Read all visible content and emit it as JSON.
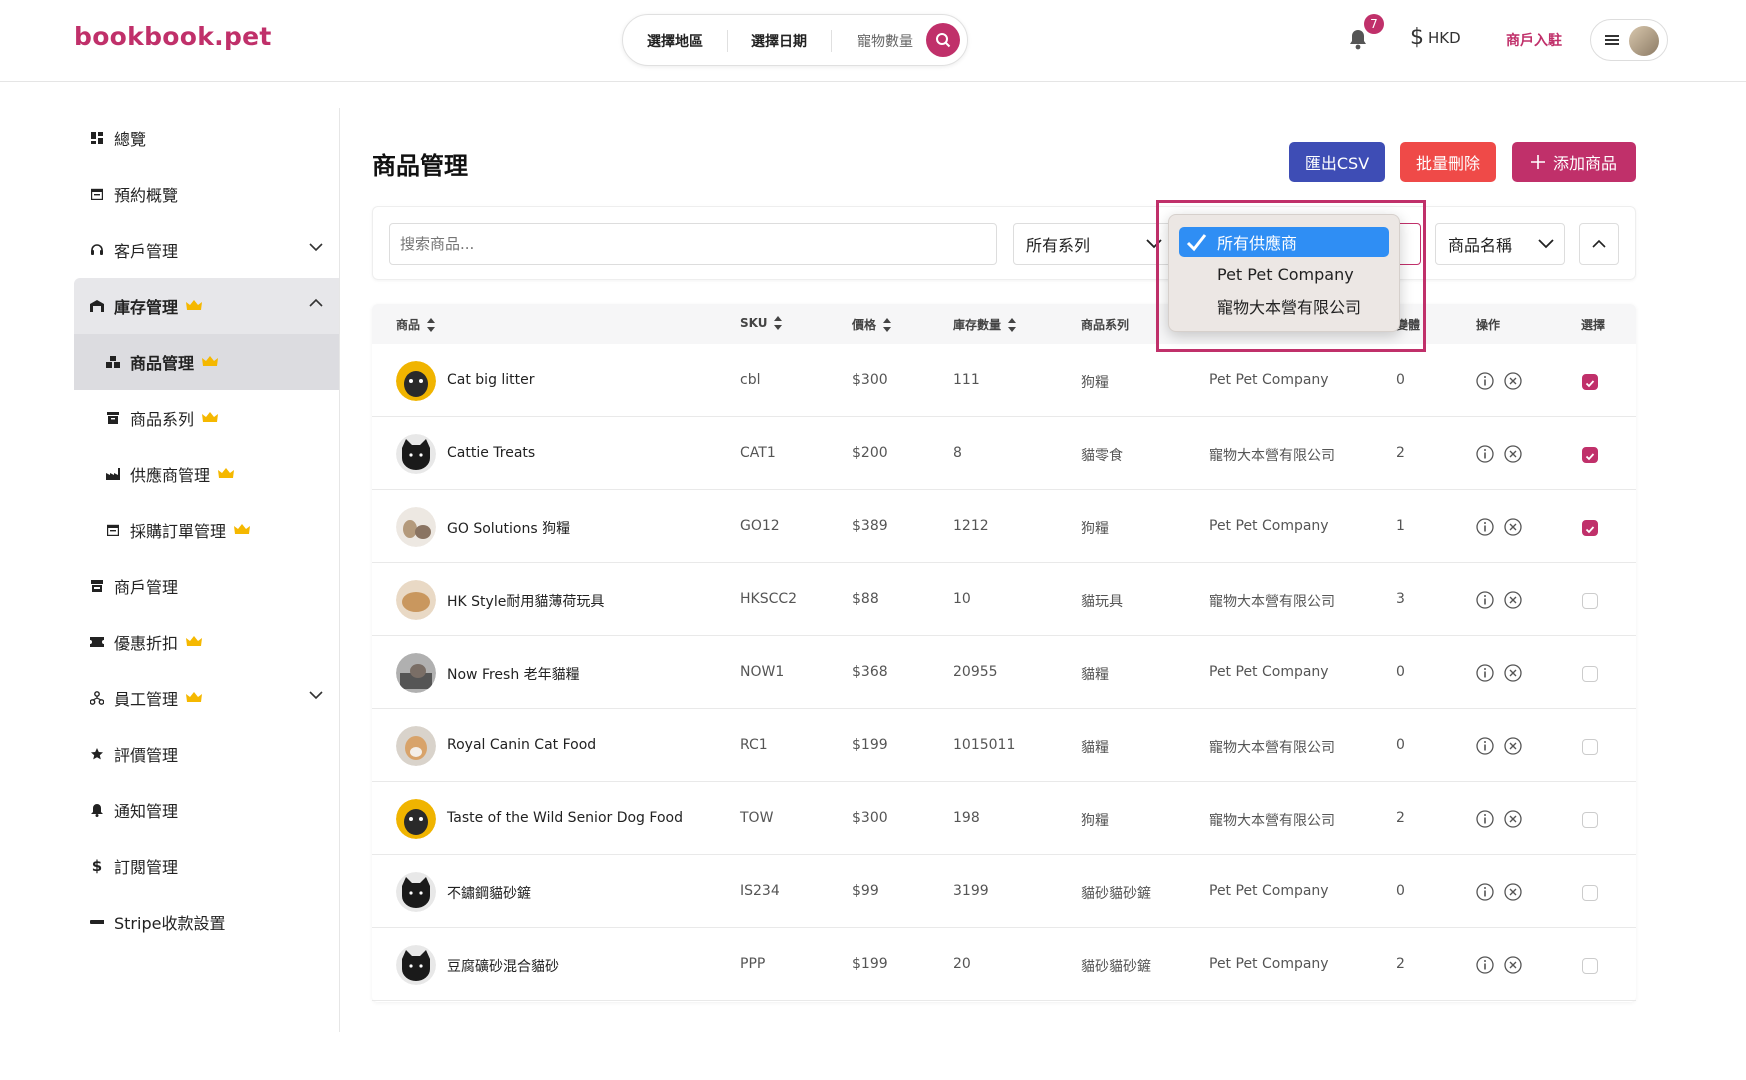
{
  "header": {
    "logo": "bookbook.pet",
    "search": {
      "region": "選擇地區",
      "date": "選擇日期",
      "pets": "寵物數量"
    },
    "notification_count": "7",
    "currency": "HKD",
    "merchant_link": "商戶入駐"
  },
  "sidebar": {
    "items": [
      {
        "label": "總覽",
        "icon": "dashboard-icon"
      },
      {
        "label": "預約概覽",
        "icon": "calendar-icon"
      },
      {
        "label": "客戶管理",
        "icon": "headset-icon"
      },
      {
        "label": "庫存管理",
        "icon": "warehouse-icon"
      },
      {
        "label": "商品管理",
        "icon": "boxes-icon"
      },
      {
        "label": "商品系列",
        "icon": "archive-icon"
      },
      {
        "label": "供應商管理",
        "icon": "factory-icon"
      },
      {
        "label": "採購訂單管理",
        "icon": "calendar-icon"
      },
      {
        "label": "商戶管理",
        "icon": "store-icon"
      },
      {
        "label": "優惠折扣",
        "icon": "ticket-icon"
      },
      {
        "label": "員工管理",
        "icon": "org-icon"
      },
      {
        "label": "評價管理",
        "icon": "star-icon"
      },
      {
        "label": "通知管理",
        "icon": "bell-icon"
      },
      {
        "label": "訂閱管理",
        "icon": "dollar-icon"
      },
      {
        "label": "Stripe收款設置",
        "icon": "stripe-icon"
      }
    ]
  },
  "page": {
    "title": "商品管理",
    "export_csv": "匯出CSV",
    "bulk_delete": "批量刪除",
    "add_product": "添加商品"
  },
  "filters": {
    "search_placeholder": "搜索商品...",
    "series_selected": "所有系列",
    "sort_selected": "商品名稱",
    "supplier_options": [
      "所有供應商",
      "Pet Pet Company",
      "寵物大本營有限公司"
    ]
  },
  "table": {
    "columns": [
      "商品",
      "SKU",
      "價格",
      "庫存數量",
      "商品系列",
      "變體",
      "操作",
      "選擇"
    ],
    "rows": [
      {
        "name": "Cat big litter",
        "sku": "cbl",
        "price": "$300",
        "stock": "111",
        "series": "狗糧",
        "supplier": "Pet Pet Company",
        "variants": "0",
        "selected": true,
        "thumb": "pug"
      },
      {
        "name": "Cattie Treats",
        "sku": "CAT1",
        "price": "$200",
        "stock": "8",
        "series": "貓零食",
        "supplier": "寵物大本營有限公司",
        "variants": "2",
        "selected": true,
        "thumb": "blackcat"
      },
      {
        "name": "GO Solutions 狗糧",
        "sku": "GO12",
        "price": "$389",
        "stock": "1212",
        "series": "狗糧",
        "supplier": "Pet Pet Company",
        "variants": "1",
        "selected": true,
        "thumb": "photo1"
      },
      {
        "name": "HK Style耐用貓薄荷玩具",
        "sku": "HKSCC2",
        "price": "$88",
        "stock": "10",
        "series": "貓玩具",
        "supplier": "寵物大本營有限公司",
        "variants": "3",
        "selected": false,
        "thumb": "photo2"
      },
      {
        "name": "Now Fresh 老年貓糧",
        "sku": "NOW1",
        "price": "$368",
        "stock": "20955",
        "series": "貓糧",
        "supplier": "Pet Pet Company",
        "variants": "0",
        "selected": false,
        "thumb": "photo3"
      },
      {
        "name": "Royal Canin Cat Food",
        "sku": "RC1",
        "price": "$199",
        "stock": "1015011",
        "series": "貓糧",
        "supplier": "寵物大本營有限公司",
        "variants": "0",
        "selected": false,
        "thumb": "photo4"
      },
      {
        "name": "Taste of the Wild Senior Dog Food",
        "sku": "TOW",
        "price": "$300",
        "stock": "198",
        "series": "狗糧",
        "supplier": "寵物大本營有限公司",
        "variants": "2",
        "selected": false,
        "thumb": "pug"
      },
      {
        "name": "不鏽鋼貓砂鏟",
        "sku": "IS234",
        "price": "$99",
        "stock": "3199",
        "series": "貓砂貓砂鏟",
        "supplier": "Pet Pet Company",
        "variants": "0",
        "selected": false,
        "thumb": "blackcat"
      },
      {
        "name": "豆腐礦砂混合貓砂",
        "sku": "PPP",
        "price": "$199",
        "stock": "20",
        "series": "貓砂貓砂鏟",
        "supplier": "Pet Pet Company",
        "variants": "2",
        "selected": false,
        "thumb": "blackcat"
      }
    ]
  },
  "colors": {
    "brand": "#c0306a",
    "csv": "#3e4db5",
    "danger": "#ef4a48",
    "select": "#2f8ef4"
  }
}
